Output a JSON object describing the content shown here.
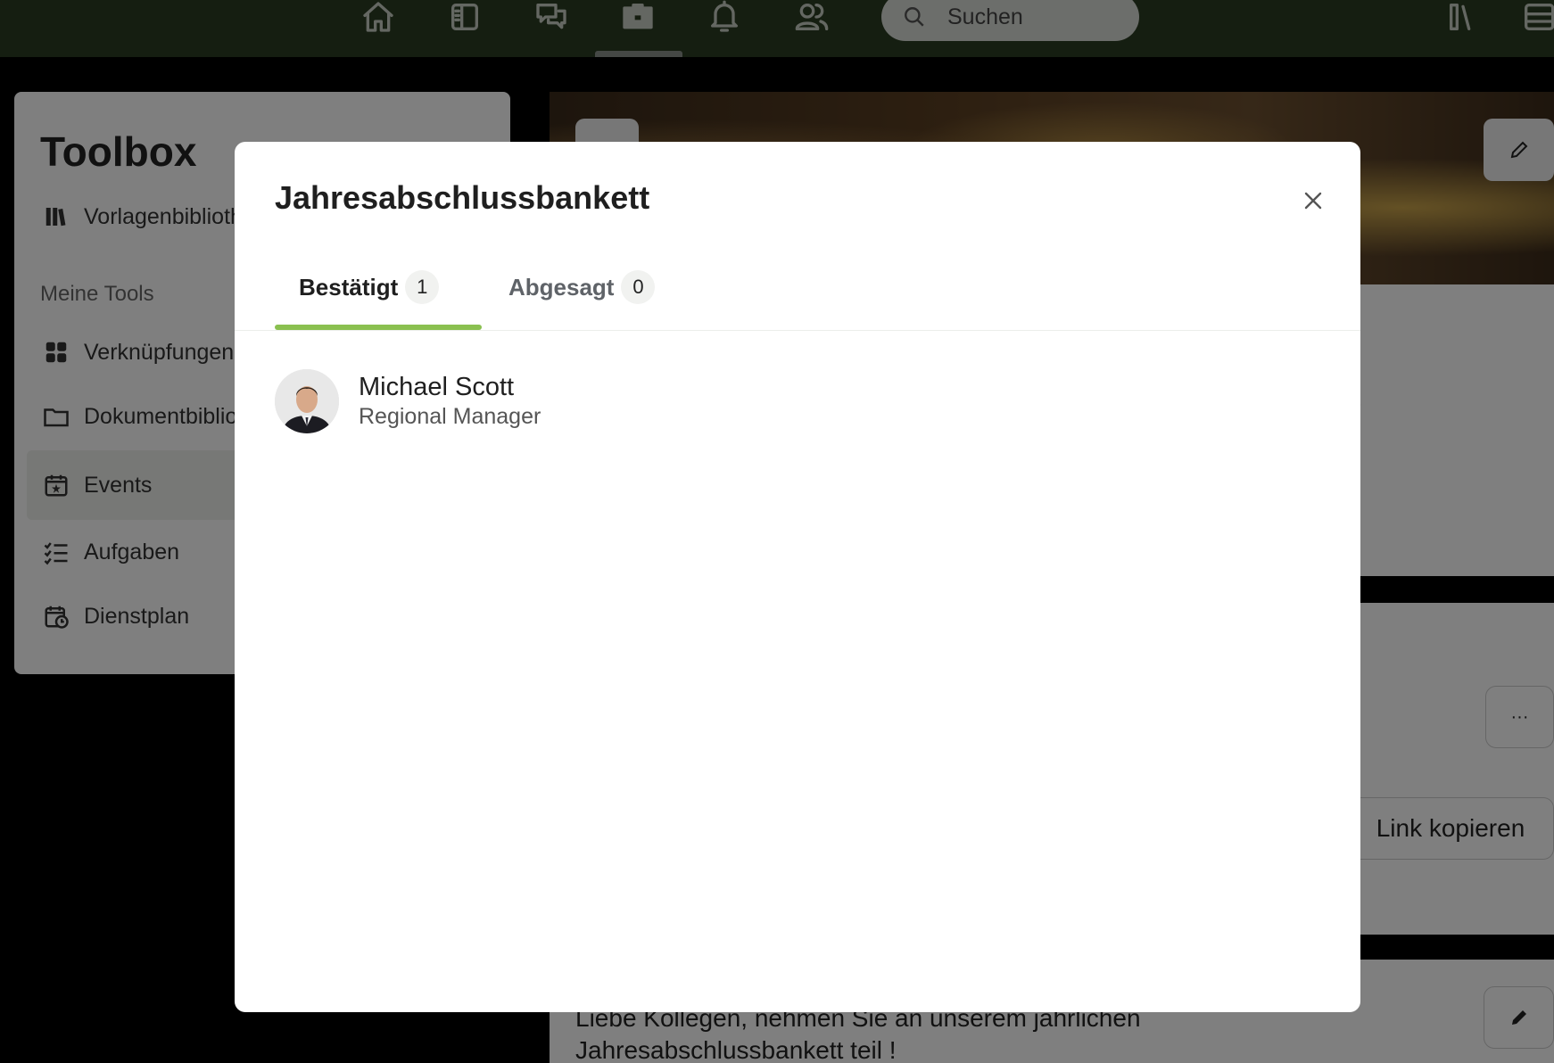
{
  "topnav": {
    "search_placeholder": "Suchen",
    "icons": [
      "home-icon",
      "sidebar-icon",
      "chat-icon",
      "toolbox-icon",
      "bell-icon",
      "people-icon",
      "library-icon",
      "inbox-icon"
    ]
  },
  "toolbox": {
    "title": "Toolbox",
    "top_item": "Vorlagenbibliothek",
    "section_label": "Meine Tools",
    "items": [
      {
        "label": "Verknüpfungen",
        "icon": "grid-icon"
      },
      {
        "label": "Dokumentbibliothek",
        "icon": "folder-icon"
      },
      {
        "label": "Events",
        "icon": "calendar-star-icon",
        "active": true
      },
      {
        "label": "Aufgaben",
        "icon": "checklist-icon"
      },
      {
        "label": "Dienstplan",
        "icon": "calendar-clock-icon"
      }
    ]
  },
  "background": {
    "copy_link_label": "Link kopieren",
    "more_label": "···",
    "partial_char": "t",
    "description": "Liebe Kollegen, nehmen Sie an unserem jährlichen Jahresabschlussbankett teil !"
  },
  "modal": {
    "title": "Jahresabschlussbankett",
    "tabs": [
      {
        "label": "Bestätigt",
        "count": "1",
        "active": true,
        "color": "#6aaa3a"
      },
      {
        "label": "Abgesagt",
        "count": "0",
        "active": false,
        "color": "#c0392b"
      }
    ],
    "members": [
      {
        "name": "Michael Scott",
        "role": "Regional Manager"
      }
    ],
    "accent_color": "#8ac050"
  }
}
